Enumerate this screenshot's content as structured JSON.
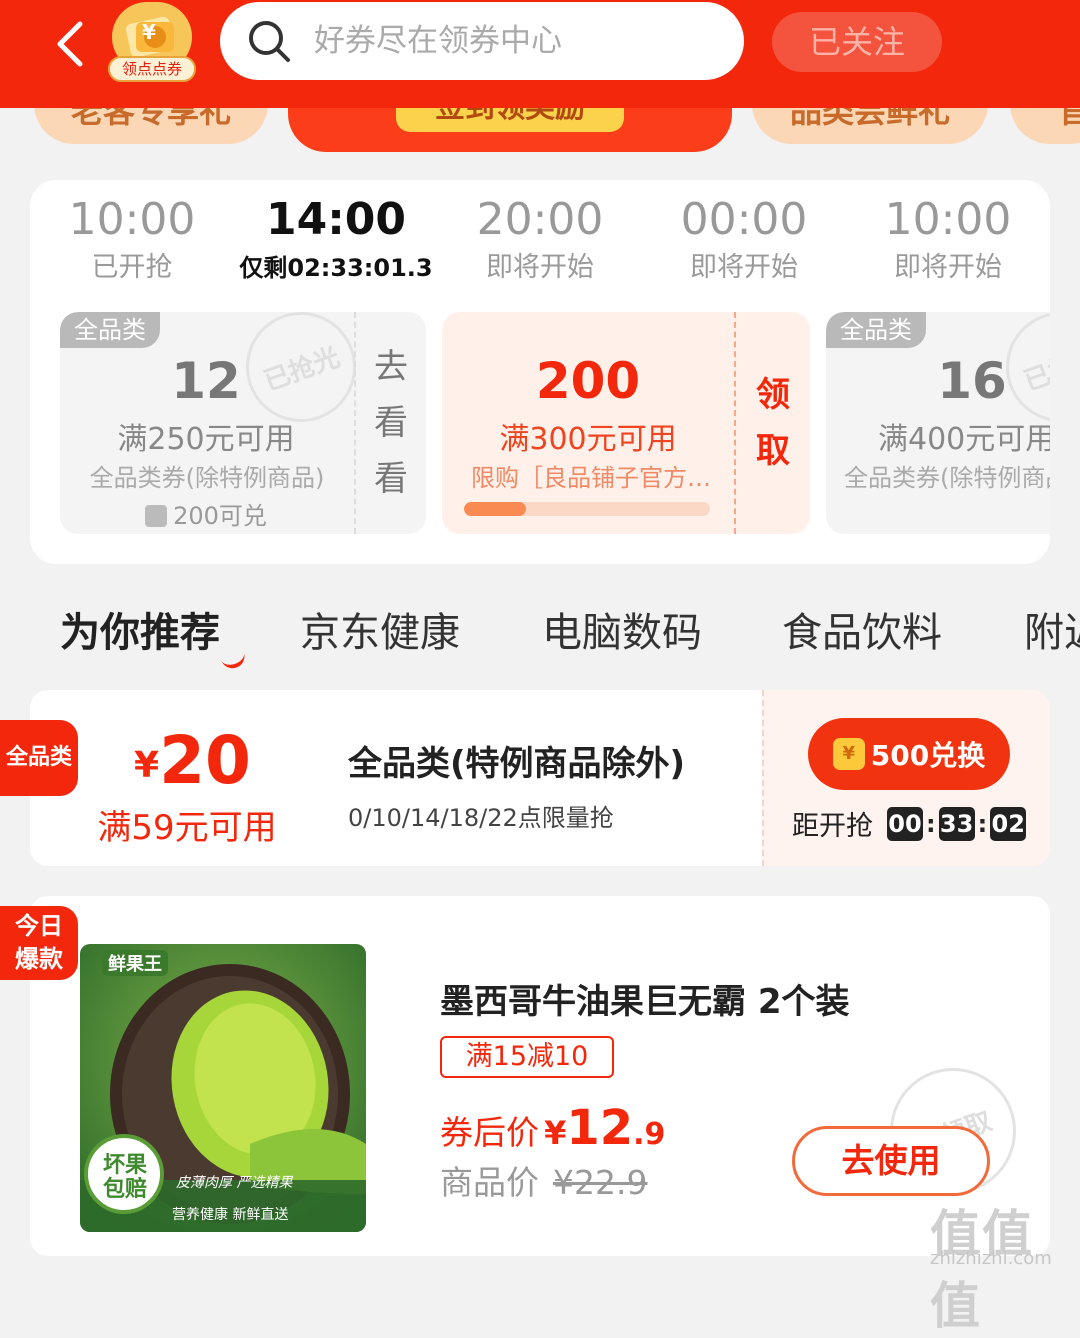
{
  "header": {
    "badge_symbol": "¥",
    "badge_label": "领点点券",
    "search_placeholder": "好券尽在领券中心",
    "follow_label": "已关注"
  },
  "promo_strip": {
    "items": [
      "老客专享礼",
      "签到领奖励",
      "品类尝鲜礼",
      "官"
    ]
  },
  "time_slots": [
    {
      "time": "10:00",
      "status": "已开抢"
    },
    {
      "time": "14:00",
      "status": "仅剩02:33:01.3"
    },
    {
      "time": "20:00",
      "status": "即将开始"
    },
    {
      "time": "00:00",
      "status": "即将开始"
    },
    {
      "time": "10:00",
      "status": "即将开始"
    }
  ],
  "slot_coupons": [
    {
      "category": "全品类",
      "amount": "12",
      "condition": "满250元可用",
      "desc": "全品类券(除特例商品)",
      "points": "200可兑",
      "stamp": "已抢光",
      "action": [
        "去",
        "看",
        "看"
      ]
    },
    {
      "amount": "200",
      "condition": "满300元可用",
      "desc": "限购［良品铺子官方…",
      "claimed_fraction": 0.25,
      "action": [
        "领",
        "取"
      ]
    },
    {
      "category": "全品类",
      "amount": "16",
      "condition": "满400元可用",
      "desc": "全品类券(除特例商品)",
      "stamp": "已抢光"
    }
  ],
  "tabs": [
    "为你推荐",
    "京东健康",
    "电脑数码",
    "食品饮料",
    "附近"
  ],
  "coupon_row": {
    "tag": "全品类",
    "currency": "¥",
    "amount": "20",
    "condition": "满59元可用",
    "title": "全品类(特例商品除外)",
    "subtitle": "0/10/14/18/22点限量抢",
    "exchange_label": "500兑换",
    "coin_symbol": "¥",
    "countdown_label": "距开抢",
    "countdown": [
      "00",
      "33",
      "02"
    ]
  },
  "product": {
    "tag_line1": "今日",
    "tag_line2": "爆款",
    "image_brand": "鲜果王",
    "image_badge_line1": "坏果",
    "image_badge_line2": "包赔",
    "image_caption1": "皮薄肉厚 严选精果",
    "image_caption2": "营养健康 新鲜直送",
    "title": "墨西哥牛油果巨无霸  2个装",
    "promo": "满15减10",
    "after_label": "券后价",
    "currency": "¥",
    "price_int": "12",
    "price_dec": ".9",
    "orig_label": "商品价",
    "orig_price": "¥22.9",
    "button": "去使用",
    "stamp": "已领取"
  },
  "watermark": {
    "main": "值值值",
    "sub": "zhizhizhi.com"
  },
  "colors": {
    "brand_red": "#f2270c",
    "header_bg": "#f2270c",
    "coin_gold": "#fbc93a"
  }
}
